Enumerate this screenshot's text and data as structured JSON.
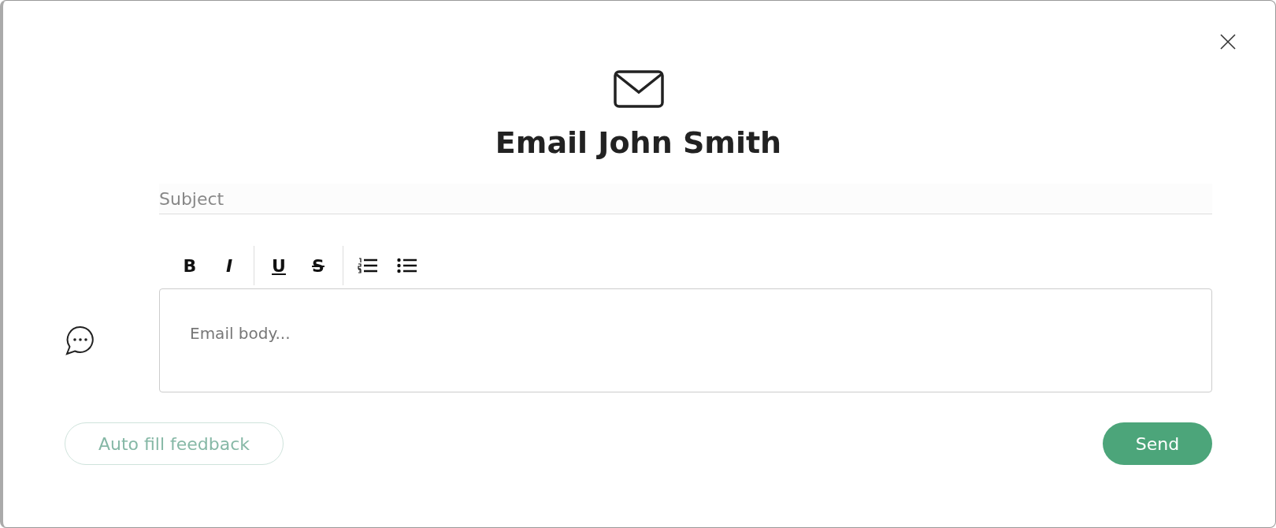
{
  "dialog": {
    "title": "Email John Smith"
  },
  "subject": {
    "placeholder": "Subject"
  },
  "toolbar": [
    {
      "kind": "bold",
      "label": "B"
    },
    {
      "kind": "italic",
      "label": "I"
    },
    {
      "kind": "underline",
      "label": "U"
    },
    {
      "kind": "strike",
      "label": "S"
    },
    {
      "kind": "ordered-list"
    },
    {
      "kind": "bullet-list"
    }
  ],
  "body": {
    "placeholder": "Email body..."
  },
  "buttons": [
    {
      "label": "Auto fill feedback",
      "disabled": true
    },
    {
      "label": "Send",
      "disabled": false
    }
  ]
}
